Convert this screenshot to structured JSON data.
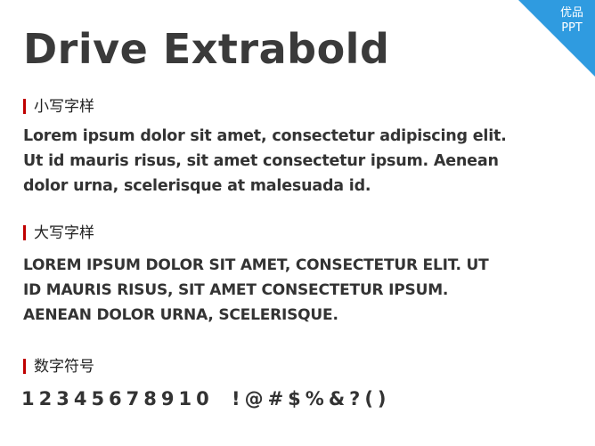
{
  "title": "Drive Extrabold",
  "badge": {
    "line1": "优品",
    "line2": "PPT",
    "color": "#2f9be0"
  },
  "accent_bar_color": "#c00000",
  "sections": {
    "lowercase": {
      "label": "小写字样",
      "lines": [
        "Lorem ipsum dolor sit amet, consectetur adipiscing elit.",
        "Ut id mauris risus, sit amet consectetur ipsum. Aenean",
        "dolor urna, scelerisque at malesuada id."
      ]
    },
    "uppercase": {
      "label": "大写字样",
      "lines": [
        "LOREM IPSUM DOLOR SIT AMET, CONSECTETUR ELIT. UT",
        "ID MAURIS RISUS, SIT AMET CONSECTETUR IPSUM.",
        "AENEAN DOLOR URNA, SCELERISQUE."
      ]
    },
    "numbers": {
      "label": "数字符号",
      "digits": "12345678910",
      "symbols": "!@#$%&?()"
    }
  }
}
